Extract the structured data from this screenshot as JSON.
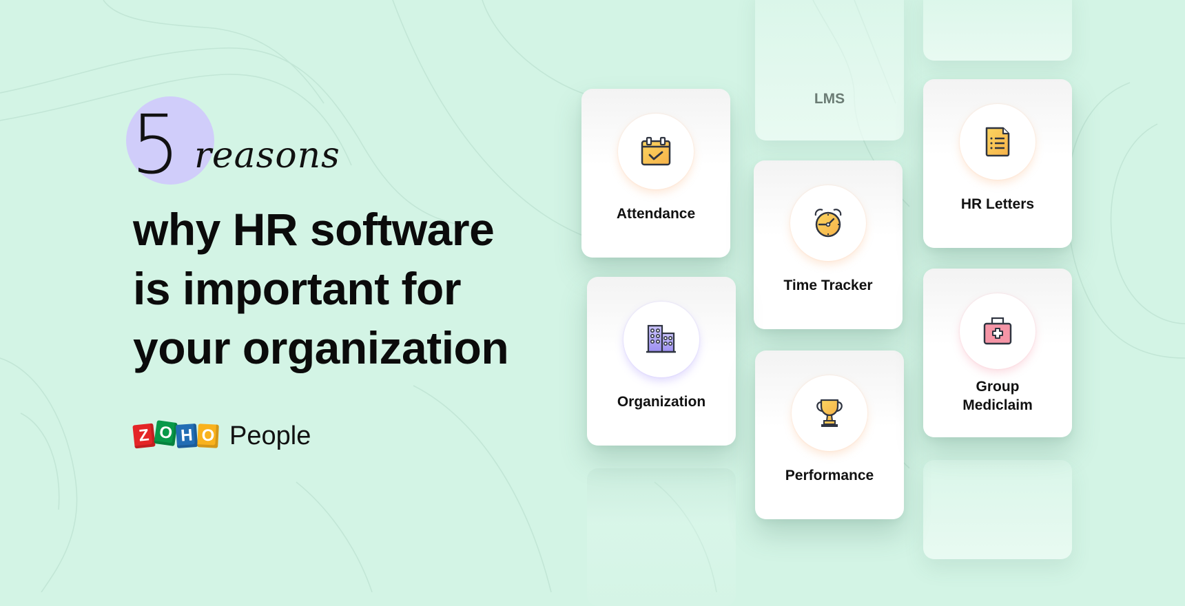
{
  "hero": {
    "badge_number": "5",
    "badge_word": "reasons",
    "headline_lines": [
      "why HR software",
      "is important for",
      "your organization"
    ]
  },
  "brand": {
    "logo_letters": [
      "Z",
      "O",
      "H",
      "O"
    ],
    "product_name": "People"
  },
  "colors": {
    "background": "#d3f4e5",
    "badge_circle": "#d0cdfa",
    "icon_yellow": "#f9c94e",
    "icon_purple": "#a79cf5",
    "icon_pink": "#f48fa0",
    "zoho_red": "#e42527",
    "zoho_green": "#089949",
    "zoho_blue": "#226db4",
    "zoho_yellow": "#f9b21d"
  },
  "cards": {
    "lms": {
      "label": "LMS"
    },
    "attendance": {
      "label": "Attendance",
      "icon": "calendar-check-icon"
    },
    "time_tracker": {
      "label": "Time Tracker",
      "icon": "alarm-clock-icon"
    },
    "hr_letters": {
      "label": "HR Letters",
      "icon": "document-list-icon"
    },
    "organization": {
      "label": "Organization",
      "icon": "buildings-icon"
    },
    "performance": {
      "label": "Performance",
      "icon": "trophy-icon"
    },
    "group_mediclaim": {
      "label_lines": [
        "Group",
        "Mediclaim"
      ],
      "icon": "medical-kit-icon"
    }
  }
}
